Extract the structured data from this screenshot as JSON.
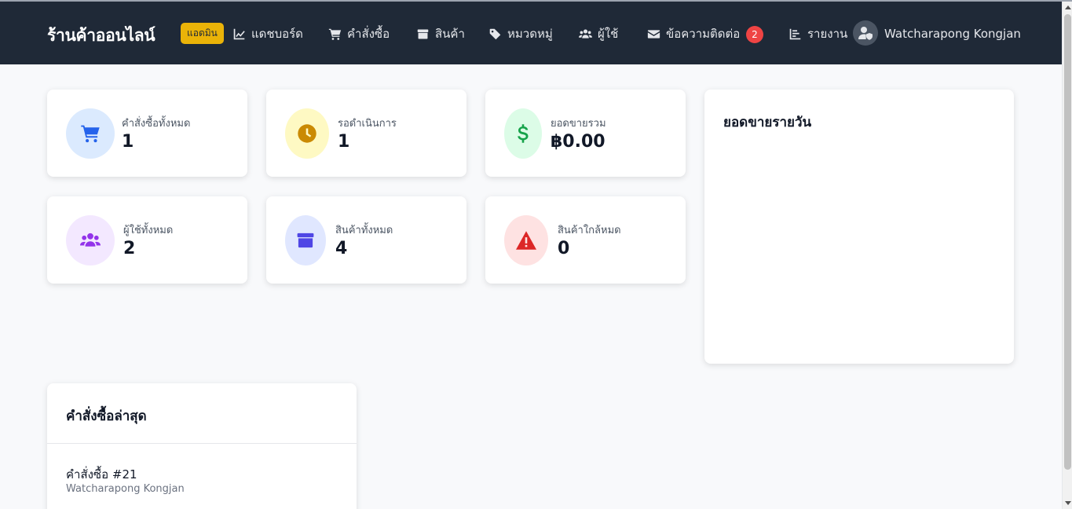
{
  "navbar": {
    "brand": "ร้านค้าออนไลน์",
    "admin_badge": "แอดมิน",
    "items": [
      {
        "label": "แดชบอร์ด",
        "icon": "chart-line-icon"
      },
      {
        "label": "คำสั่งซื้อ",
        "icon": "cart-icon"
      },
      {
        "label": "สินค้า",
        "icon": "box-icon"
      },
      {
        "label": "หมวดหมู่",
        "icon": "tags-icon"
      },
      {
        "label": "ผู้ใช้",
        "icon": "users-icon"
      },
      {
        "label": "ข้อความติดต่อ",
        "icon": "envelope-icon",
        "badge": "2"
      },
      {
        "label": "รายงาน",
        "icon": "chart-bar-icon"
      }
    ],
    "user": {
      "name": "Watcharapong Kongjan",
      "icon": "user-shield-icon"
    }
  },
  "stats": [
    {
      "label": "คำสั่งซื้อทั้งหมด",
      "value": "1",
      "icon": "cart-icon",
      "color": "#2563eb",
      "bg": "#dbeafe"
    },
    {
      "label": "รอดำเนินการ",
      "value": "1",
      "icon": "clock-icon",
      "color": "#ca8a04",
      "bg": "#fef9c3"
    },
    {
      "label": "ยอดขายรวม",
      "value": "฿0.00",
      "icon": "dollar-icon",
      "color": "#16a34a",
      "bg": "#dcfce7"
    },
    {
      "label": "ผู้ใช้ทั้งหมด",
      "value": "2",
      "icon": "users-icon",
      "color": "#9333ea",
      "bg": "#f3e8ff"
    },
    {
      "label": "สินค้าทั้งหมด",
      "value": "4",
      "icon": "box-icon",
      "color": "#4f46e5",
      "bg": "#e0e7ff"
    },
    {
      "label": "สินค้าใกล้หมด",
      "value": "0",
      "icon": "warning-icon",
      "color": "#dc2626",
      "bg": "#fee2e2"
    }
  ],
  "daily_sales": {
    "title": "ยอดขายรายวัน"
  },
  "recent_orders": {
    "title": "คำสั่งซื้อล่าสุด",
    "items": [
      {
        "title": "คำสั่งซื้อ #21",
        "customer": "Watcharapong Kongjan"
      }
    ]
  }
}
